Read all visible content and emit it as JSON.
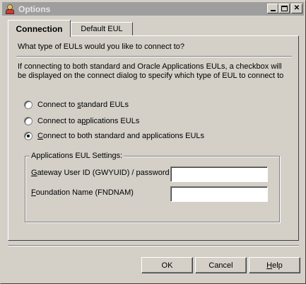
{
  "window": {
    "title": "Options",
    "minimize_icon": "minimize-icon",
    "maximize_icon": "maximize-icon",
    "close_icon": "close-icon",
    "close_glyph": "✕"
  },
  "tabs": [
    {
      "label": "Connection",
      "active": true
    },
    {
      "label": "Default EUL",
      "active": false
    }
  ],
  "connection": {
    "question": "What type of EULs would you like to connect to?",
    "info": "If connecting to both standard and Oracle Applications EULs, a checkbox will be displayed on the connect dialog to specify which type of EUL to connect to",
    "options": [
      {
        "pre": "Connect to ",
        "u": "s",
        "post": "tandard EULs",
        "checked": false
      },
      {
        "pre": "Connect to a",
        "u": "p",
        "post": "plications EULs",
        "checked": false
      },
      {
        "pre": "",
        "u": "C",
        "post": "onnect to both standard and applications EULs",
        "checked": true
      }
    ],
    "group_title": "Applications EUL Settings:",
    "fields": [
      {
        "pre": "",
        "u": "G",
        "post": "ateway User ID (GWYUID) / password",
        "value": ""
      },
      {
        "pre": "",
        "u": "F",
        "post": "oundation Name (FNDNAM)",
        "value": ""
      }
    ]
  },
  "buttons": {
    "ok": "OK",
    "cancel": "Cancel",
    "help_u": "H",
    "help_rest": "elp"
  }
}
